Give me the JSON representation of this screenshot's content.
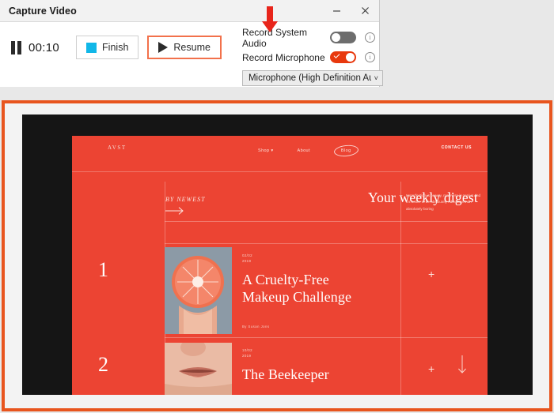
{
  "recorder": {
    "window_title": "Capture Video",
    "minimize_label": "minimize",
    "close_label": "close",
    "timer": "00:10",
    "pause_icon": "pause-icon",
    "finish_label": "Finish",
    "resume_label": "Resume",
    "options": [
      {
        "label": "Record System Audio",
        "state": "off",
        "info_glyph": "i"
      },
      {
        "label": "Record Microphone",
        "state": "on",
        "info_glyph": "i"
      }
    ],
    "mic_select": {
      "value": "Microphone (High Definition Aud",
      "caret_glyph": "˅"
    },
    "colors": {
      "accent_orange": "#e8551e",
      "toggle_on": "#e8380d",
      "toggle_off": "#6d6d6d",
      "finish_square": "#11b7e8",
      "resume_border": "#f2714b",
      "annotation_arrow": "#e8251b"
    }
  },
  "annotation": {
    "arrow": "down-arrow pointing at Record System Audio toggle"
  },
  "captured_site": {
    "brand": "AVST",
    "nav": [
      {
        "label": "Shop ▾"
      },
      {
        "label": "About"
      },
      {
        "label": "Blog"
      }
    ],
    "contact_label": "CONTACT US",
    "sort_label": "BY NEWEST",
    "headline": "Your  weekly digest",
    "quote": "Imperfection is beauty, madness is genius and it's better to be absolutely ridiculous than absolutely boring",
    "articles": [
      {
        "index": "1",
        "date_line1": "02/02",
        "date_line2": "2019",
        "title_line1": "A Cruelty-Free",
        "title_line2": "Makeup Challenge",
        "byline": "By Susan Jons",
        "expand": "+",
        "thumb": "grapefruit-slice-in-hand"
      },
      {
        "index": "2",
        "date_line1": "10/02",
        "date_line2": "2019",
        "title_line1": "The Beekeeper",
        "title_line2": "",
        "byline": "",
        "expand": "+",
        "thumb": "close-up-lips-portrait"
      }
    ],
    "scroll_hint": "scroll-down-arrow",
    "background_color": "#ec4433"
  }
}
